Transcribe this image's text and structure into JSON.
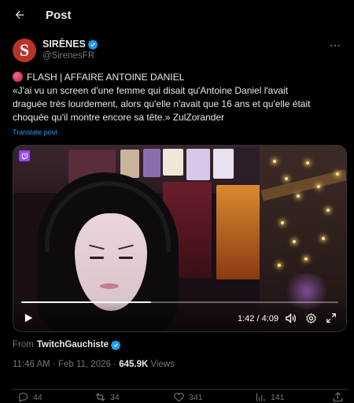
{
  "header": {
    "title": "Post"
  },
  "author": {
    "avatar_letter": "S",
    "display_name": "SIRÈNES",
    "handle": "@SirenesFR"
  },
  "tweet": {
    "line1": "FLASH | AFFAIRE ANTOINE DANIEL",
    "line2": "«J'ai vu un screen d'une femme qui disait qu'Antoine Daniel l'avait",
    "line3": "draguée très lourdement, alors qu'elle n'avait que 16 ans et qu'elle était",
    "line4": "choquée qu'il montre encore sa tête.»  ZulZorander",
    "translate_label": "Translate post"
  },
  "video": {
    "current_time": "1:42",
    "duration": "4:09",
    "time_display": "1:42 / 4:09",
    "progress_fraction": 0.41
  },
  "source": {
    "from_label": "From",
    "from_name": "TwitchGauchiste"
  },
  "meta": {
    "time": "11:46 AM",
    "separator": "·",
    "date": "Feb 11, 2026",
    "views_count": "645.9K",
    "views_label": "Views"
  },
  "actions": {
    "replies": "44",
    "reposts": "34",
    "likes": "341",
    "bookmarks": "141"
  },
  "colors": {
    "accent": "#1d9bf0",
    "avatar_bg": "#b9332a",
    "background": "#000000",
    "muted_text": "#71767b"
  },
  "icons": [
    "back-arrow-icon",
    "verified-badge-icon",
    "more-icon",
    "red-circle-emoji-icon",
    "twitch-icon",
    "play-icon",
    "volume-icon",
    "settings-icon",
    "fullscreen-icon",
    "reply-icon",
    "repost-icon",
    "like-icon",
    "bookmark-icon",
    "share-icon"
  ]
}
